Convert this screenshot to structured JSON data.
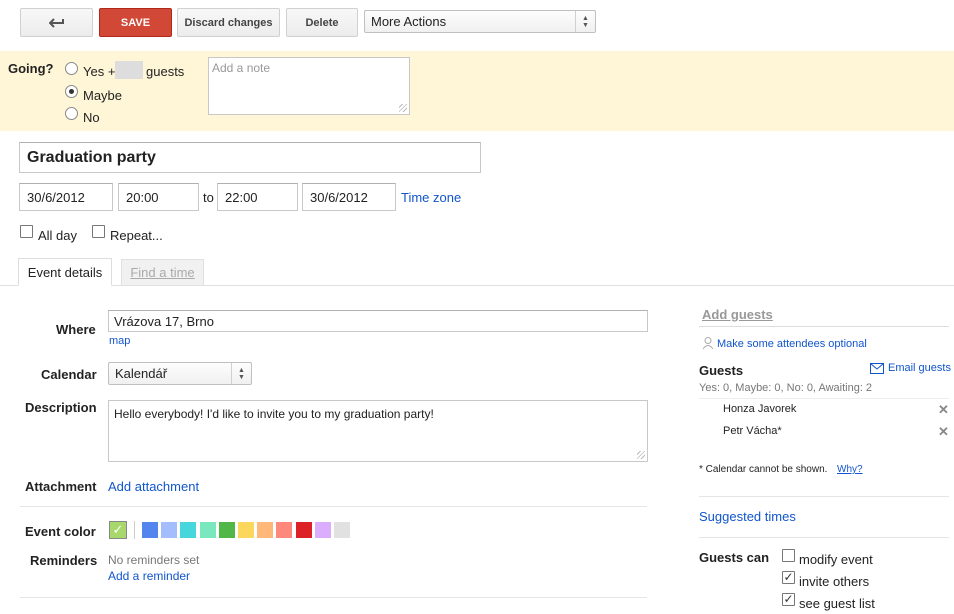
{
  "toolbar": {
    "back_icon": "back-arrow-icon",
    "save_label": "SAVE",
    "discard_label": "Discard changes",
    "delete_label": "Delete",
    "more_actions_label": "More Actions"
  },
  "rsvp": {
    "label": "Going?",
    "yes_label": "Yes +",
    "guests_suffix": "guests",
    "guest_count": "",
    "maybe_label": "Maybe",
    "no_label": "No",
    "selected": "Maybe",
    "note_placeholder": "Add a note"
  },
  "event": {
    "title": "Graduation party",
    "start_date": "30/6/2012",
    "start_time": "20:00",
    "to_label": "to",
    "end_time": "22:00",
    "end_date": "30/6/2012",
    "timezone_link": "Time zone",
    "all_day_label": "All day",
    "repeat_label": "Repeat..."
  },
  "tabs": {
    "details": "Event details",
    "find_time": "Find a time"
  },
  "details": {
    "where_label": "Where",
    "where_value": "Vrázova 17, Brno",
    "map_link": "map",
    "calendar_label": "Calendar",
    "calendar_value": "Kalendář",
    "description_label": "Description",
    "description_value": "Hello everybody! I'd like to invite you to my graduation party!",
    "attachment_label": "Attachment",
    "add_attachment_link": "Add attachment",
    "event_color_label": "Event color",
    "colors": [
      "#5484ed",
      "#a4bdfc",
      "#46d6db",
      "#7ae7bf",
      "#51b749",
      "#fbd75b",
      "#ffb878",
      "#ff887c",
      "#dc2127",
      "#dbadff",
      "#e1e1e1"
    ],
    "default_color": "#a8d86c",
    "reminders_label": "Reminders",
    "no_reminders_text": "No reminders set",
    "add_reminder_link": "Add a reminder"
  },
  "guests_panel": {
    "add_guests_placeholder": "Add guests",
    "optional_link": "Make some attendees optional",
    "guests_heading": "Guests",
    "email_guests_link": "Email guests",
    "counts": "Yes: 0, Maybe: 0, No: 0, Awaiting: 2",
    "guests": [
      {
        "name": "Honza Javorek"
      },
      {
        "name": "Petr Vácha*"
      }
    ],
    "calendar_note": "* Calendar cannot be shown.",
    "why_link": "Why?",
    "suggested_times_link": "Suggested times",
    "guests_can_label": "Guests can",
    "permissions": [
      {
        "label": "modify event",
        "checked": false
      },
      {
        "label": "invite others",
        "checked": true
      },
      {
        "label": "see guest list",
        "checked": true
      }
    ]
  }
}
